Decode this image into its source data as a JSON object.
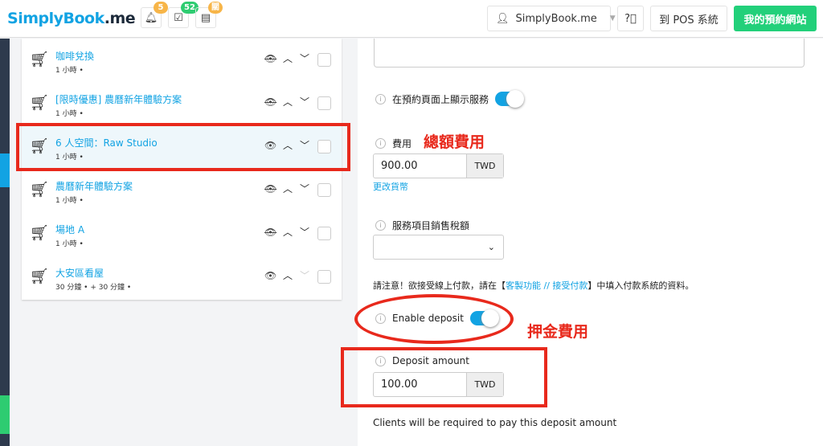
{
  "header": {
    "logo": "SimplyBook.me",
    "badges": {
      "notifications": "5",
      "bookings": "52",
      "other": "關"
    },
    "account": "SimplyBook.me",
    "pos_label": "到 POS 系統",
    "site_label": "我的預約網站",
    "colors": {
      "accent": "#12a3e3",
      "green": "#2ecc71",
      "orange": "#f7b548"
    }
  },
  "services": [
    {
      "name": "咖啡兌換",
      "duration": "1 小時 •",
      "visible": false
    },
    {
      "name": "[限時優惠] 農曆新年體驗方案",
      "duration": "1 小時 •",
      "visible": false
    },
    {
      "name": "6 人空間：Raw Studio",
      "duration": "1 小時 •",
      "visible": true,
      "selected": true
    },
    {
      "name": "農曆新年體驗方案",
      "duration": "1 小時 •",
      "visible": false
    },
    {
      "name": "場地 A",
      "duration": "1 小時 •",
      "visible": false
    },
    {
      "name": "大安區看屋",
      "duration": "30 分鐘 • + 30 分鐘 •",
      "visible": true
    }
  ],
  "form": {
    "show_on_booking_label": "在預約頁面上顯示服務",
    "show_on_booking": true,
    "price_label": "費用",
    "price": "900.00",
    "currency": "TWD",
    "change_currency": "更改貨幣",
    "tax_label": "服務項目銷售稅額",
    "tax_value": "",
    "note_prefix": "請注意！欲接受線上付款，請在【",
    "note_link": "客製功能 // 接受付款",
    "note_suffix": "】中填入付款系統的資料。",
    "deposit_label": "Enable deposit",
    "deposit_enabled": true,
    "deposit_amount_label": "Deposit amount",
    "deposit_amount": "100.00",
    "deposit_currency": "TWD",
    "deposit_note": "Clients will be required to pay this deposit amount"
  },
  "annotations": {
    "total": "總額費用",
    "deposit": "押金費用"
  }
}
